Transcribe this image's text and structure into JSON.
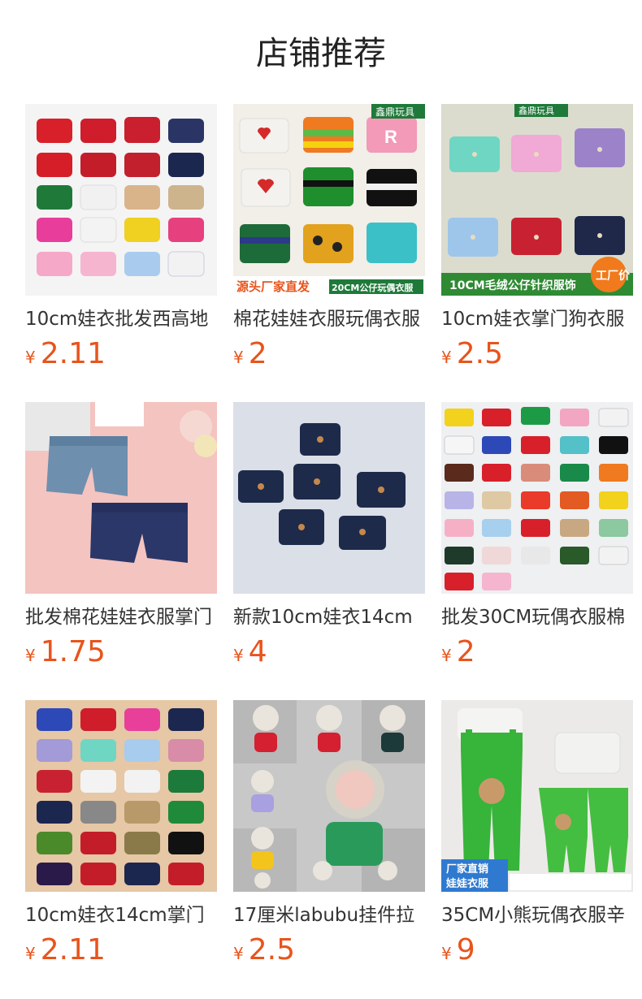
{
  "header": {
    "title": "店铺推荐"
  },
  "colors": {
    "price": "#e8541c",
    "text": "#333333"
  },
  "products": [
    {
      "name": "10cm娃衣批发西高地",
      "currency": "¥",
      "price": "2.11",
      "image": "knit-sweaters-white-bg"
    },
    {
      "name": "棉花娃娃衣服玩偶衣服",
      "currency": "¥",
      "price": "2",
      "image": "sweaters-grid",
      "image_text": {
        "brand": "鑫鼎玩具",
        "promo": "源头厂家直发",
        "spec": "20CM公仔玩偶衣服"
      }
    },
    {
      "name": "10cm娃衣掌门狗衣服",
      "currency": "¥",
      "price": "2.5",
      "image": "cardigans-grid",
      "image_text": {
        "brand": "鑫鼎玩具",
        "slogan": "10CM毛绒公仔针织服饰",
        "badge": "工厂价"
      }
    },
    {
      "name": "批发棉花娃娃衣服掌门",
      "currency": "¥",
      "price": "1.75",
      "image": "denim-shorts"
    },
    {
      "name": "新款10cm娃衣14cm",
      "currency": "¥",
      "price": "4",
      "image": "navy-cardigans"
    },
    {
      "name": "批发30CM玩偶衣服棉",
      "currency": "¥",
      "price": "2",
      "image": "many-sweaters"
    },
    {
      "name": "10cm娃衣14cm掌门",
      "currency": "¥",
      "price": "2.11",
      "image": "sweaters-beige-bg"
    },
    {
      "name": "17厘米labubu挂件拉",
      "currency": "¥",
      "price": "2.5",
      "image": "plush-dolls"
    },
    {
      "name": "35CM小熊玩偶衣服辛",
      "currency": "¥",
      "price": "9",
      "image": "green-overalls",
      "image_text": {
        "promo_line1": "厂家直销",
        "promo_line2": "娃娃衣服"
      }
    }
  ]
}
